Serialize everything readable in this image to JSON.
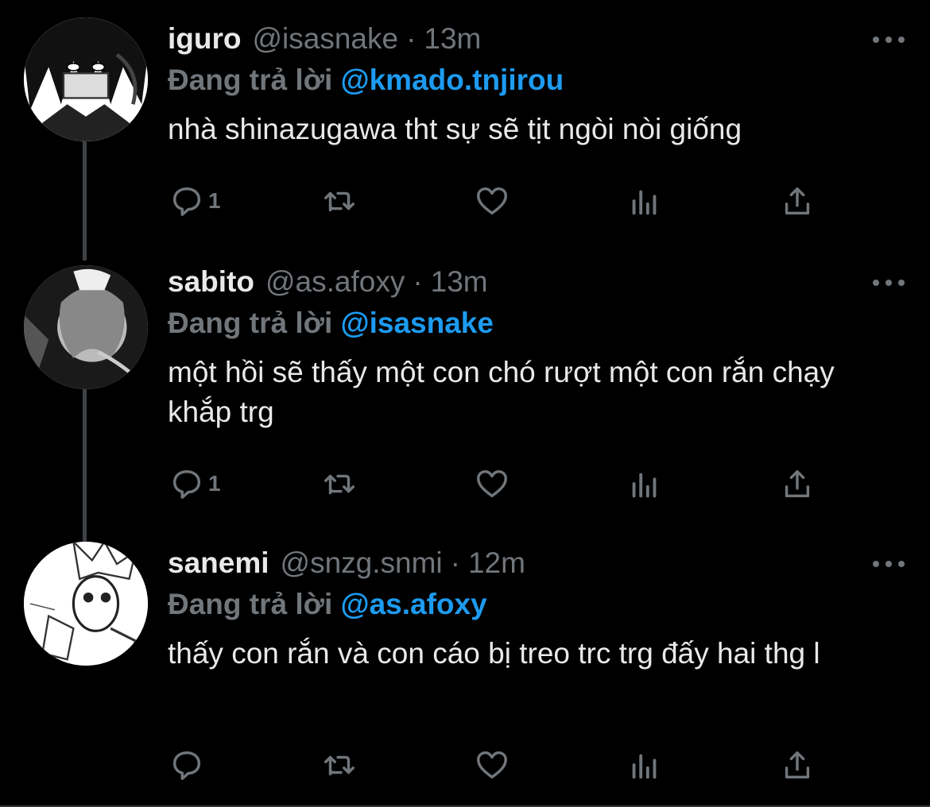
{
  "tweets": [
    {
      "name": "iguro",
      "handle": "@isasnake",
      "dot": "·",
      "time": "13m",
      "reply_prefix": "Đang trả lời",
      "reply_to": "@kmado.tnjirou",
      "text": "nhà shinazugawa tht sự sẽ tịt ngòi nòi giống",
      "reply_count": "1"
    },
    {
      "name": "sabito",
      "handle": "@as.afoxy",
      "dot": "·",
      "time": "13m",
      "reply_prefix": "Đang trả lời",
      "reply_to": "@isasnake",
      "text": "một hồi sẽ thấy một con chó rượt một con rắn chạy khắp trg",
      "reply_count": "1"
    },
    {
      "name": "sanemi",
      "handle": "@snzg.snmi",
      "dot": "·",
      "time": "12m",
      "reply_prefix": "Đang trả lời",
      "reply_to": "@as.afoxy",
      "text": "thấy con rắn và con cáo bị treo trc trg đấy hai thg l",
      "reply_count": ""
    }
  ],
  "icons": [
    "reply-icon",
    "retweet-icon",
    "like-icon",
    "analytics-icon",
    "share-icon",
    "more-icon"
  ],
  "colors": {
    "background": "#000000",
    "text": "#e7e9ea",
    "secondary": "#71767b",
    "mention": "#1d9bf0",
    "thread_line": "#3e4144"
  }
}
